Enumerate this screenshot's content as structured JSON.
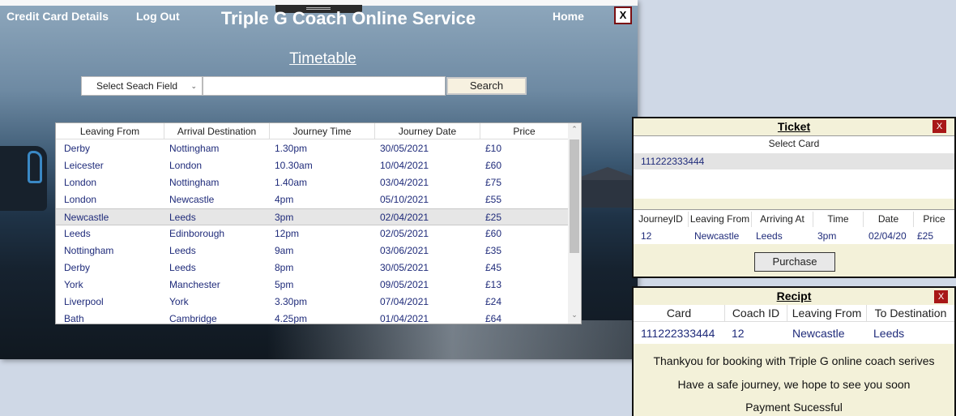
{
  "window": {
    "title": "Triple G Coach Online Service",
    "nav": {
      "credit_card": "Credit Card Details",
      "logout": "Log Out",
      "home": "Home",
      "close": "X"
    }
  },
  "timetable": {
    "heading": "Timetable",
    "search_field": "Select Seach Field",
    "search_value": "",
    "search_button": "Search",
    "columns": [
      "Leaving From",
      "Arrival Destination",
      "Journey Time",
      "Journey Date",
      "Price"
    ],
    "rows": [
      [
        "Derby",
        "Nottingham",
        "1.30pm",
        "30/05/2021",
        "£10"
      ],
      [
        "Leicester",
        "London",
        "10.30am",
        "10/04/2021",
        "£60"
      ],
      [
        "London",
        "Nottingham",
        "1.40am",
        "03/04/2021",
        "£75"
      ],
      [
        "London",
        "Newcastle",
        "4pm",
        "05/10/2021",
        "£55"
      ],
      [
        "Newcastle",
        "Leeds",
        "3pm",
        "02/04/2021",
        "£25"
      ],
      [
        "Leeds",
        "Edinborough",
        "12pm",
        "02/05/2021",
        "£60"
      ],
      [
        "Nottingham",
        "Leeds",
        "9am",
        "03/06/2021",
        "£35"
      ],
      [
        "Derby",
        "Leeds",
        "8pm",
        "30/05/2021",
        "£45"
      ],
      [
        "York",
        "Manchester",
        "5pm",
        "09/05/2021",
        "£13"
      ],
      [
        "Liverpool",
        "York",
        "3.30pm",
        "07/04/2021",
        "£24"
      ],
      [
        "Bath",
        "Cambridge",
        "4.25pm",
        "01/04/2021",
        "£64"
      ]
    ],
    "selected_row": 4
  },
  "ticket": {
    "title": "Ticket",
    "close": "X",
    "select_card_label": "Select Card",
    "cards": [
      "111222333444"
    ],
    "columns": [
      "JourneyID",
      "Leaving From",
      "Arriving At",
      "Time",
      "Date",
      "Price"
    ],
    "row": [
      "12",
      "Newcastle",
      "Leeds",
      "3pm",
      "02/04/20",
      "£25"
    ],
    "purchase_button": "Purchase"
  },
  "receipt": {
    "title": "Recipt",
    "close": "X",
    "columns": [
      "Card",
      "Coach ID",
      "Leaving From",
      "To Destination"
    ],
    "row": [
      "111222333444",
      "12",
      "Newcastle",
      "Leeds"
    ],
    "messages": [
      "Thankyou for booking with Triple G online coach serives",
      "Have a safe journey, we hope to see you soon",
      "Payment Sucessful"
    ]
  }
}
